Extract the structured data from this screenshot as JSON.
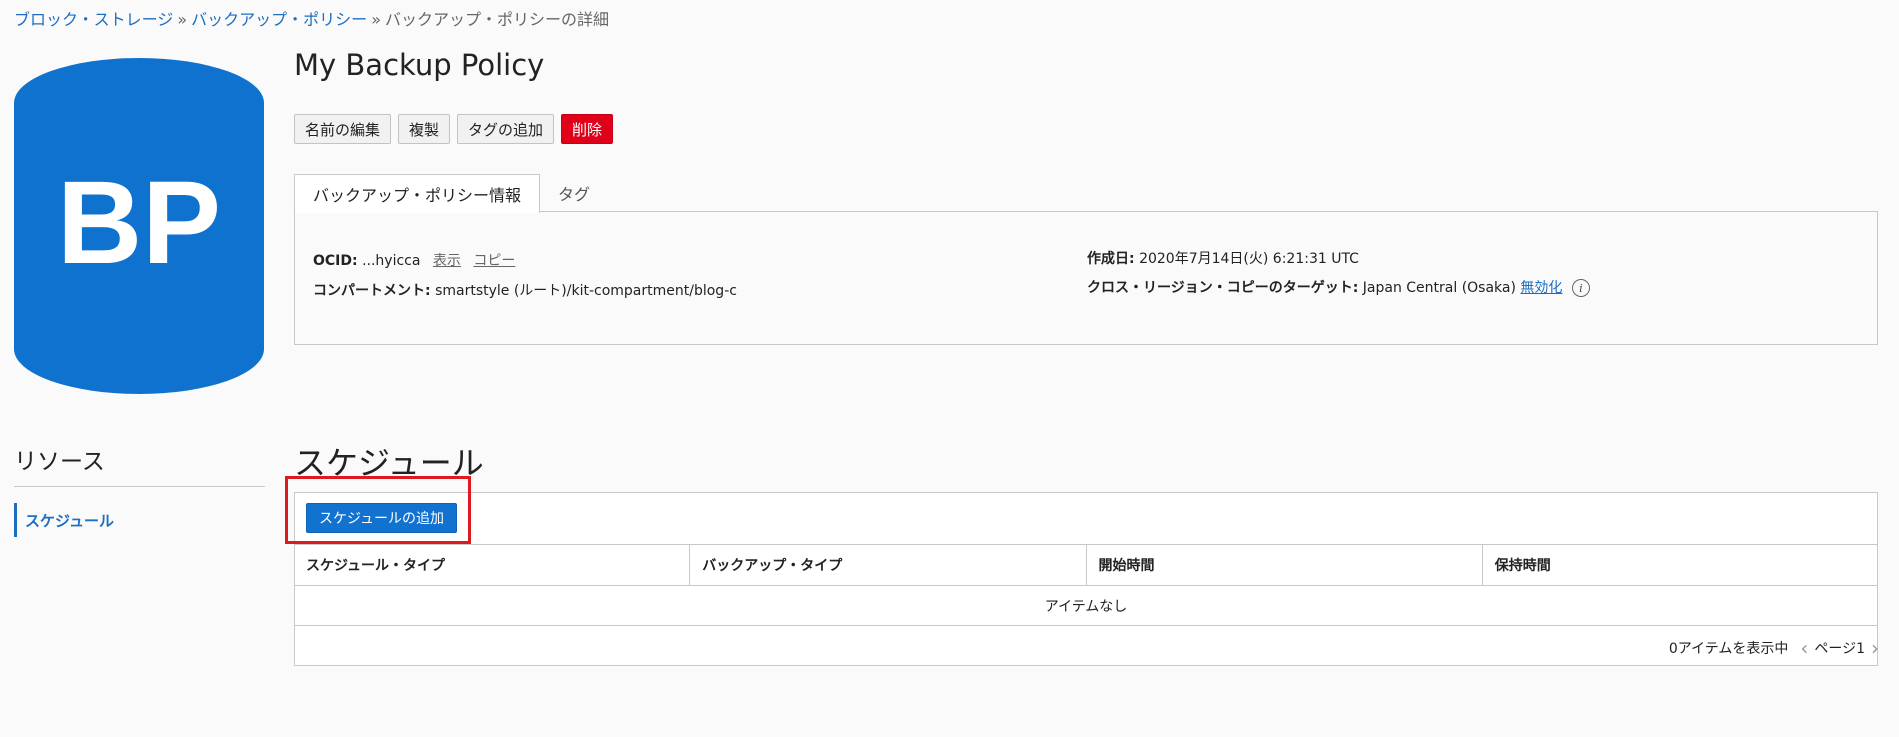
{
  "breadcrumb": {
    "item1": "ブロック・ストレージ",
    "item2": "バックアップ・ポリシー",
    "current": "バックアップ・ポリシーの詳細",
    "separator": "»"
  },
  "icon": {
    "letters": "BP",
    "color": "#0f72cf"
  },
  "policy": {
    "title": "My Backup Policy"
  },
  "actions": {
    "rename": "名前の編集",
    "duplicate": "複製",
    "add_tag": "タグの追加",
    "delete": "削除"
  },
  "tabs": {
    "info": "バックアップ・ポリシー情報",
    "tags": "タグ"
  },
  "info": {
    "ocid_label": "OCID:",
    "ocid_value": "...hyicca",
    "show_link": "表示",
    "copy_link": "コピー",
    "compartment_label": "コンパートメント:",
    "compartment_value": "smartstyle (ルート)/kit-compartment/blog-c",
    "created_label": "作成日:",
    "created_value": "2020年7月14日(火) 6:21:31 UTC",
    "cross_region_label": "クロス・リージョン・コピーのターゲット:",
    "cross_region_value": "Japan Central (Osaka)",
    "disable_link": "無効化",
    "info_glyph": "i"
  },
  "resources": {
    "title": "リソース",
    "items": [
      "スケジュール"
    ]
  },
  "schedule": {
    "title": "スケジュール",
    "add_button": "スケジュールの追加",
    "columns": [
      "スケジュール・タイプ",
      "バックアップ・タイプ",
      "開始時間",
      "保持時間"
    ],
    "empty_text": "アイテムなし",
    "count_text": "0アイテムを表示中",
    "page_text": "ページ1"
  },
  "colors": {
    "accent": "#1272cf",
    "danger": "#e0001a",
    "highlight": "#e0191e"
  }
}
